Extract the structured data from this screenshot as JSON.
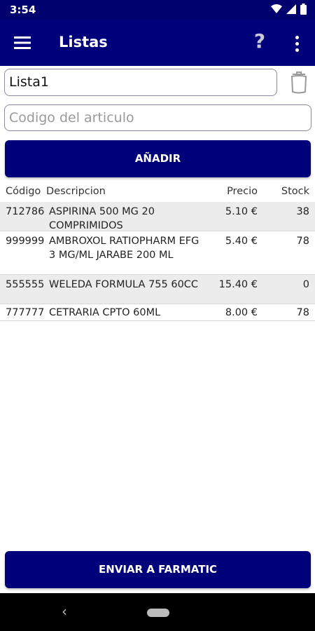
{
  "status": {
    "time": "3:54"
  },
  "appbar": {
    "title": "Listas",
    "help": "?"
  },
  "form": {
    "list_name": "Lista1",
    "code_placeholder": "Codigo del articulo",
    "add_label": "AÑADIR"
  },
  "table": {
    "headers": {
      "code": "Código",
      "desc": "Descripcion",
      "price": "Precio",
      "stock": "Stock"
    },
    "rows": [
      {
        "code": "712786",
        "desc": "ASPIRINA 500 MG 20 COMPRIMIDOS",
        "price": "5.10 €",
        "stock": "38"
      },
      {
        "code": "999999",
        "desc": "AMBROXOL RATIOPHARM EFG 3 MG/ML JARABE 200 ML",
        "price": "5.40 €",
        "stock": "78"
      },
      {
        "code": "555555",
        "desc": "WELEDA FORMULA 755 60CC",
        "price": "15.40 €",
        "stock": "0"
      },
      {
        "code": "777777",
        "desc": "CETRARIA CPTO 60ML",
        "price": "8.00 €",
        "stock": "78"
      }
    ]
  },
  "footer": {
    "send_label": "ENVIAR A FARMATIC"
  },
  "colors": {
    "primary": "#00007a",
    "status_bar": "#00006e",
    "row_alt": "#ececec"
  }
}
